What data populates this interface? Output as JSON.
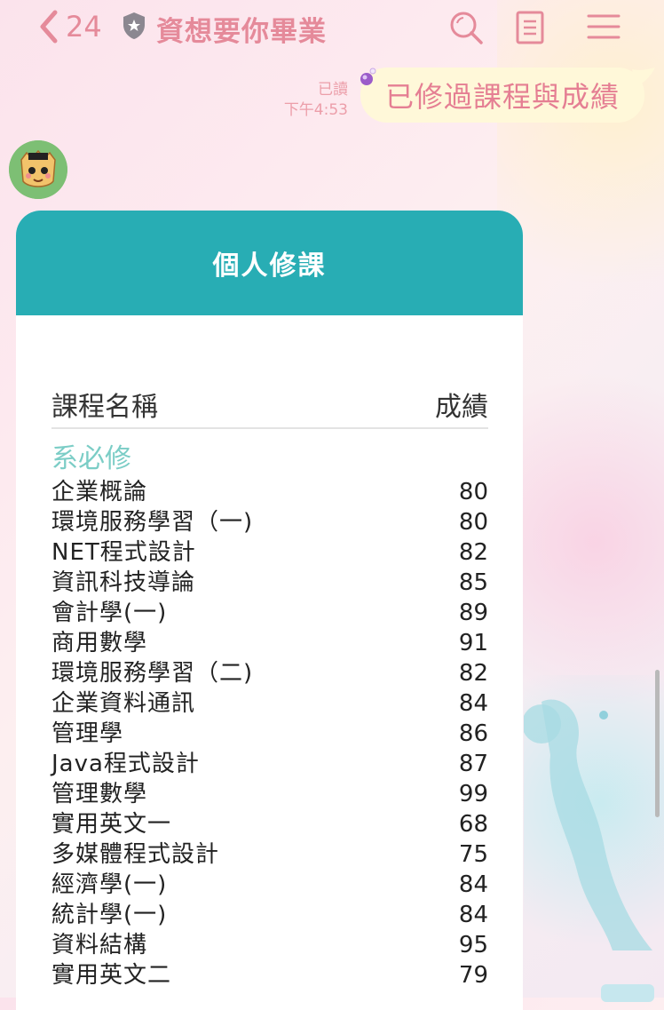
{
  "header": {
    "back_count": "24",
    "title": "資想要你畢業",
    "icons": [
      "chevron-left-icon",
      "shield-icon",
      "search-icon",
      "notes-icon",
      "menu-icon"
    ]
  },
  "message": {
    "read_label": "已讀",
    "time": "下午4:53",
    "text": "已修過課程與成績"
  },
  "card": {
    "title": "個人修課",
    "col_course": "課程名稱",
    "col_grade": "成績",
    "section": "系必修",
    "courses": [
      {
        "name": "企業概論",
        "grade": "80"
      },
      {
        "name": "環境服務學習（一)",
        "grade": "80"
      },
      {
        "name": "NET程式設計",
        "grade": "82"
      },
      {
        "name": "資訊科技導論",
        "grade": "85"
      },
      {
        "name": "會計學(一)",
        "grade": "89"
      },
      {
        "name": "商用數學",
        "grade": "91"
      },
      {
        "name": "環境服務學習（二)",
        "grade": "82"
      },
      {
        "name": "企業資料通訊",
        "grade": "84"
      },
      {
        "name": "管理學",
        "grade": "86"
      },
      {
        "name": "Java程式設計",
        "grade": "87"
      },
      {
        "name": "管理數學",
        "grade": "99"
      },
      {
        "name": "實用英文一",
        "grade": "68"
      },
      {
        "name": "多媒體程式設計",
        "grade": "75"
      },
      {
        "name": "經濟學(一)",
        "grade": "84"
      },
      {
        "name": "統計學(一)",
        "grade": "84"
      },
      {
        "name": "資料結構",
        "grade": "95"
      },
      {
        "name": "實用英文二",
        "grade": "79"
      }
    ]
  },
  "colors": {
    "accent": "#e58a9a",
    "card_header": "#28adb4",
    "section_color": "#7bcdc6",
    "bubble": "#fff8d9"
  }
}
